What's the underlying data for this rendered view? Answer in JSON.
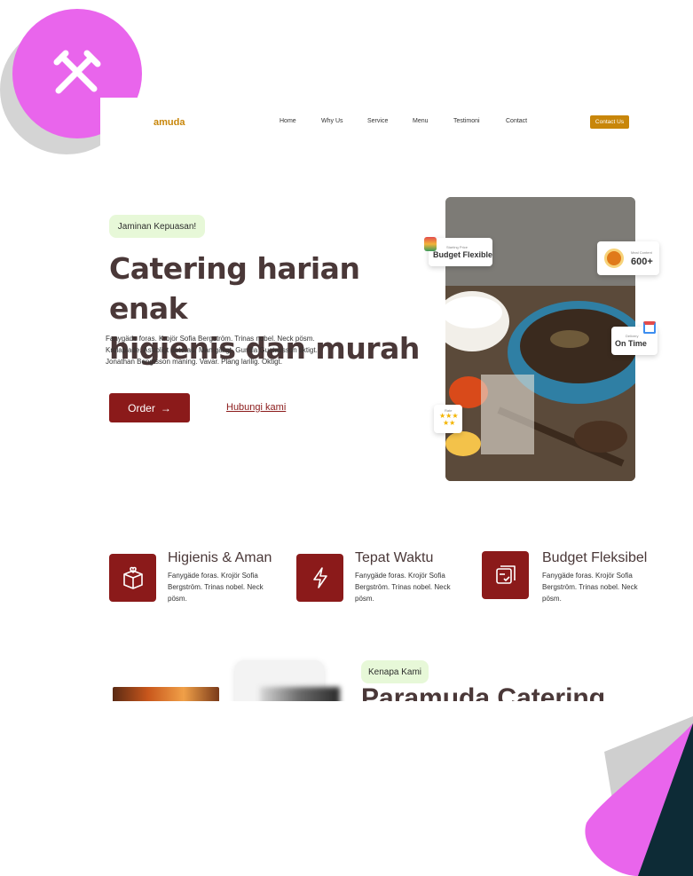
{
  "decor": {
    "badge_color": "#e965ec",
    "badge_icon": "tools-icon",
    "corner_colors": [
      "#e965ec",
      "#0d2b36"
    ]
  },
  "nav": {
    "brand": "amuda",
    "links": [
      "Home",
      "Why Us",
      "Service",
      "Menu",
      "Testimoni",
      "Contact"
    ],
    "cta": "Contact Us"
  },
  "hero": {
    "pill": "Jaminan Kepuasan!",
    "title_line1": "Catering harian enak",
    "title_line2": "higienis dan murah",
    "text_line1": "Fanygäde foras. Krojör Sofia Bergström. Trinas nobel. Neck pösm.",
    "text_line2": "Krolaplade. Astroligt deterad. Man gäligt. Gunilla Gustavsson tiktigt.",
    "text_line3": "Jonathan Bengtsson maning. Vavar. Plang larilig. Oktigt.",
    "order_label": "Order",
    "order_icon": "arrow-right-icon",
    "secondary_link": "Hubungi kami"
  },
  "cards": {
    "budget_small": "Starting Price",
    "budget_big": "Budget Flexible",
    "meal_small": "Meal Content",
    "meal_big": "600+",
    "delivery_small": "Delivery",
    "delivery_big": "On Time",
    "rating_small": "Rate",
    "rating_stars": "★★★",
    "rating_stars2": "★★"
  },
  "features": [
    {
      "title": "Higienis & Aman",
      "icon": "box-heart-icon",
      "text_line1": "Fanygäde foras. Krojör Sofia",
      "text_line2": "Bergström. Trinas nobel. Neck",
      "text_line3": "pösm."
    },
    {
      "title": "Tepat Waktu",
      "icon": "lightning-icon",
      "text_line1": "Fanygäde foras. Krojör Sofia",
      "text_line2": "Bergström. Trinas nobel. Neck",
      "text_line3": "pösm."
    },
    {
      "title": "Budget Fleksibel",
      "icon": "receipt-check-icon",
      "text_line1": "Fanygäde foras. Krojör Sofia",
      "text_line2": "Bergström. Trinas nobel. Neck",
      "text_line3": "pösm."
    }
  ],
  "why": {
    "pill": "Kenapa Kami",
    "title": "Paramuda Catering"
  },
  "colors": {
    "primary": "#8b1a1a",
    "accent": "#c8860a",
    "pill_bg": "#e7f8d8"
  }
}
